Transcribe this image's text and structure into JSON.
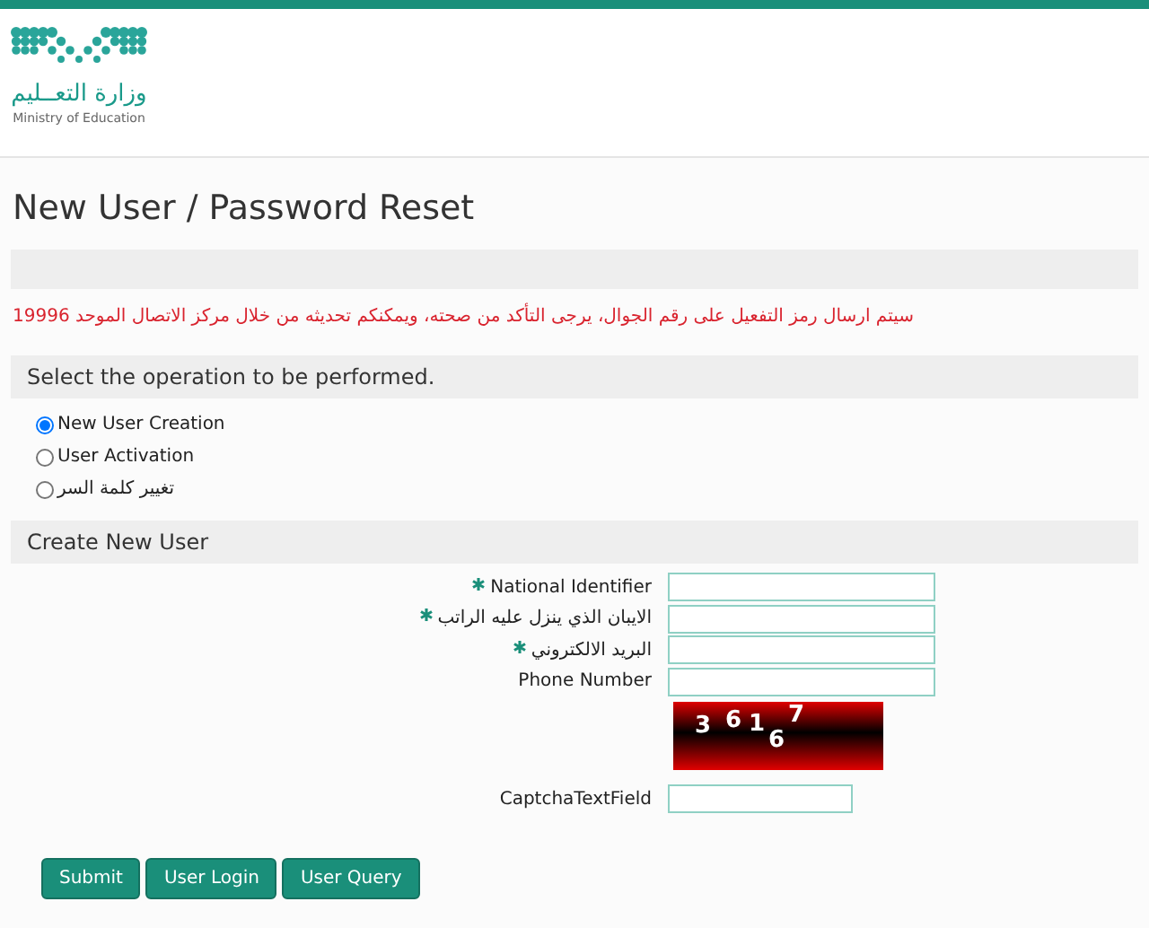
{
  "logo": {
    "arabic": "وزارة التعــليم",
    "english": "Ministry of Education"
  },
  "title": "New User / Password Reset",
  "notice": "سيتم ارسال رمز التفعيل على رقم الجوال، يرجى التأكد من صحته، ويمكنكم تحديثه من خلال مركز الاتصال الموحد 19996",
  "operation_section": {
    "heading": "Select the operation to be performed.",
    "options": [
      {
        "label": "New User Creation",
        "selected": true
      },
      {
        "label": "User Activation",
        "selected": false
      },
      {
        "label": "تغيير كلمة السر",
        "selected": false
      }
    ]
  },
  "form_section": {
    "heading": "Create New User",
    "fields": [
      {
        "label": "National Identifier",
        "required": true
      },
      {
        "label": "الايبان الذي ينزل عليه الراتب",
        "required": true
      },
      {
        "label": "البريد الالكتروني",
        "required": true
      },
      {
        "label": "Phone Number",
        "required": false
      }
    ],
    "captcha": {
      "digits": [
        "3",
        "6",
        "1",
        "6",
        "7"
      ]
    },
    "captcha_field": {
      "label": "CaptchaTextField"
    }
  },
  "buttons": [
    "Submit",
    "User Login",
    "User Query"
  ]
}
